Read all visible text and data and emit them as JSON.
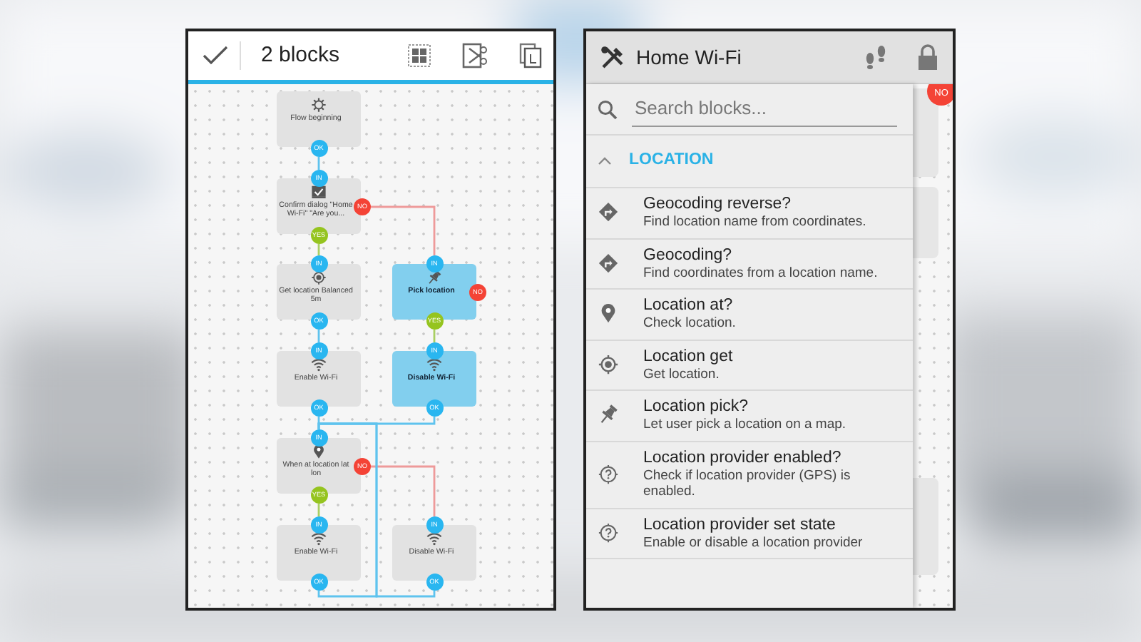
{
  "editor": {
    "title": "2 blocks",
    "nodes": [
      {
        "title": "Flow beginning",
        "kind": "gear",
        "selected": false,
        "ports": [
          {
            "label": "OK",
            "kind": "ok"
          }
        ]
      },
      {
        "title": "Confirm dialog \"Home Wi-Fi\" \"Are you...",
        "kind": "dialog",
        "selected": false,
        "ports": [
          {
            "label": "IN",
            "kind": "in"
          },
          {
            "label": "NO",
            "kind": "no"
          },
          {
            "label": "YES",
            "kind": "yes"
          }
        ]
      },
      {
        "title": "Get location Balanced 5m",
        "kind": "target",
        "selected": false,
        "ports": [
          {
            "label": "IN",
            "kind": "in"
          },
          {
            "label": "OK",
            "kind": "ok"
          }
        ]
      },
      {
        "title": "Pick location",
        "kind": "pushpin",
        "selected": true,
        "ports": [
          {
            "label": "IN",
            "kind": "in"
          },
          {
            "label": "NO",
            "kind": "no"
          },
          {
            "label": "YES",
            "kind": "yes"
          }
        ]
      },
      {
        "title": "Enable Wi-Fi",
        "kind": "wifi",
        "selected": false,
        "ports": [
          {
            "label": "IN",
            "kind": "in"
          },
          {
            "label": "OK",
            "kind": "ok"
          }
        ]
      },
      {
        "title": "Disable Wi-Fi",
        "kind": "wifi",
        "selected": true,
        "ports": [
          {
            "label": "IN",
            "kind": "in"
          },
          {
            "label": "OK",
            "kind": "ok"
          }
        ]
      },
      {
        "title": "When at location lat lon",
        "kind": "marker",
        "selected": false,
        "ports": [
          {
            "label": "IN",
            "kind": "in"
          },
          {
            "label": "NO",
            "kind": "no"
          },
          {
            "label": "YES",
            "kind": "yes"
          }
        ]
      },
      {
        "title": "Enable Wi-Fi",
        "kind": "wifi",
        "selected": false,
        "ports": [
          {
            "label": "IN",
            "kind": "in"
          },
          {
            "label": "OK",
            "kind": "ok"
          }
        ]
      },
      {
        "title": "Disable Wi-Fi",
        "kind": "wifi",
        "selected": false,
        "ports": [
          {
            "label": "IN",
            "kind": "in"
          },
          {
            "label": "OK",
            "kind": "ok"
          }
        ]
      }
    ]
  },
  "drawer": {
    "title": "Home Wi-Fi",
    "search": {
      "placeholder": "Search blocks..."
    },
    "section": {
      "label": "LOCATION",
      "expanded": true
    },
    "items": [
      {
        "title": "Geocoding reverse?",
        "description": "Find location name from coordinates.",
        "kind": "turn-sign"
      },
      {
        "title": "Geocoding?",
        "description": "Find coordinates from a location name.",
        "kind": "turn-sign"
      },
      {
        "title": "Location at?",
        "description": "Check location.",
        "kind": "marker"
      },
      {
        "title": "Location get",
        "description": "Get location.",
        "kind": "target"
      },
      {
        "title": "Location pick?",
        "description": "Let user pick a location on a map.",
        "kind": "pushpin"
      },
      {
        "title": "Location provider enabled?",
        "description": "Check if location provider (GPS) is enabled.",
        "kind": "question-target"
      },
      {
        "title": "Location provider set state",
        "description": "Enable or disable a location provider",
        "kind": "question-target"
      }
    ]
  },
  "behind_drawer": {
    "port_label": "NO"
  }
}
